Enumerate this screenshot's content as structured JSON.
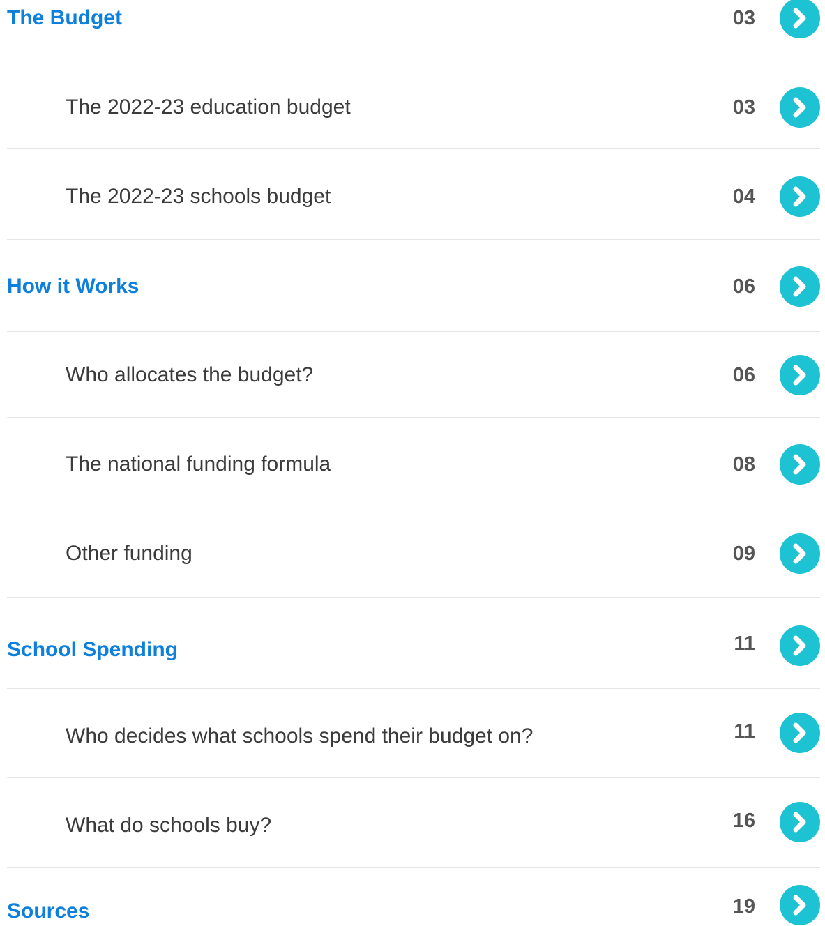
{
  "accent_color": "#0d7fdc",
  "arrow_color": "#1ec3d3",
  "icon": "chevron-right-icon",
  "toc": [
    {
      "kind": "section",
      "label": "The Budget",
      "page": "03"
    },
    {
      "kind": "sub",
      "label": "The 2022-23 education budget",
      "page": "03"
    },
    {
      "kind": "sub",
      "label": "The 2022-23 schools budget",
      "page": "04"
    },
    {
      "kind": "section",
      "label": "How it Works",
      "page": "06"
    },
    {
      "kind": "sub",
      "label": "Who allocates the budget?",
      "page": "06"
    },
    {
      "kind": "sub",
      "label": "The national funding formula",
      "page": "08"
    },
    {
      "kind": "sub",
      "label": "Other funding",
      "page": "09"
    },
    {
      "kind": "section",
      "label": "School Spending",
      "page": "11"
    },
    {
      "kind": "sub",
      "label": "Who decides what schools spend their budget on?",
      "page": "11"
    },
    {
      "kind": "sub",
      "label": "What do schools buy?",
      "page": "16"
    },
    {
      "kind": "section",
      "label": "Sources",
      "page": "19"
    }
  ]
}
